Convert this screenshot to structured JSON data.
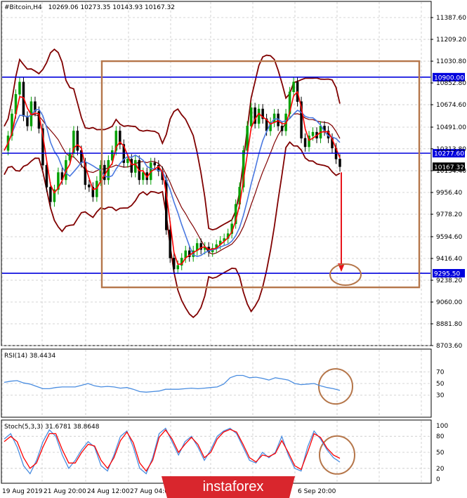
{
  "header": {
    "symbol": "#Bitcoin,H4",
    "ohlc": "10269.06 10273.35 10143.93 10167.32"
  },
  "colors": {
    "price_line_blue": "#0000dd",
    "band_color": "#800000",
    "ma_fast": "#ff0000",
    "ma_slow": "#4a78e0",
    "box_brown": "#b5764a",
    "arrow_red": "#e8141b",
    "indicator_blue": "#4a8de0",
    "watermark_bg": "#d9262d"
  },
  "main_axis": {
    "ticks": [
      "11387.60",
      "11209.20",
      "11030.80",
      "10852.80",
      "10674.60",
      "10491.00",
      "10313.80",
      "10134.40",
      "9956.40",
      "9778.20",
      "9594.60",
      "9416.40",
      "9238.20",
      "9060.00",
      "8881.80",
      "8703.60"
    ],
    "levels": [
      {
        "name": "resistance",
        "value": 10900.0,
        "label": "10900.00"
      },
      {
        "name": "pivot",
        "value": 10277.6,
        "label": "10277.60"
      },
      {
        "name": "support",
        "value": 9295.5,
        "label": "9295.50"
      }
    ],
    "current": {
      "value": 10167.32,
      "label": "10167.32"
    }
  },
  "rsi": {
    "title": "RSI(14) 38.4434",
    "ticks": [
      "70",
      "50",
      "30"
    ]
  },
  "stoch": {
    "title": "Stoch(5,3,3) 31.6781 38.8648",
    "ticks": [
      "100",
      "80",
      "50",
      "20",
      "0"
    ]
  },
  "time_axis": {
    "labels": [
      "19 Aug 2019",
      "21 Aug 20:00",
      "24 Aug 12:00",
      "27 Aug 04:00",
      "6 Sep 20:00"
    ]
  },
  "watermark": "instaforex",
  "chart_data": [
    {
      "type": "line",
      "title": "#Bitcoin,H4",
      "series": [
        {
          "name": "close",
          "values": [
            10300,
            10420,
            10600,
            10760,
            10860,
            10580,
            10500,
            10700,
            10620,
            10480,
            10180,
            10000,
            9880,
            9980,
            10120,
            10060,
            10220,
            10280,
            10460,
            10300,
            10200,
            10020,
            10000,
            9920,
            10050,
            10180,
            10060,
            10220,
            10300,
            10460,
            10350,
            10200,
            10230,
            10120,
            10220,
            10060,
            10120,
            10060,
            10200,
            10180,
            10130,
            10060,
            9650,
            9420,
            9330,
            9360,
            9420,
            9480,
            9430,
            9480,
            9540,
            9490,
            9510,
            9470,
            9500,
            9530,
            9560,
            9580,
            9620,
            9700,
            9860,
            10000,
            10300,
            10500,
            10650,
            10520,
            10640,
            10560,
            10460,
            10530,
            10600,
            10500,
            10460,
            10600,
            10780,
            10860,
            10700,
            10400,
            10330,
            10420,
            10450,
            10400,
            10500,
            10460,
            10400,
            10320,
            10230,
            10167
          ]
        },
        {
          "name": "resistance level",
          "values": [
            10900
          ]
        },
        {
          "name": "pivot level",
          "values": [
            10277.6
          ]
        },
        {
          "name": "support level",
          "values": [
            9295.5
          ]
        }
      ],
      "ylim": [
        8703.6,
        11387.6
      ]
    },
    {
      "type": "line",
      "title": "RSI(14) 38.4434",
      "series": [
        {
          "name": "RSI",
          "values": [
            52,
            54,
            55,
            51,
            49,
            45,
            41,
            41,
            43,
            44,
            44,
            44,
            47,
            50,
            46,
            44,
            45,
            44,
            42,
            43,
            40,
            36,
            35,
            36,
            37,
            40,
            40,
            40,
            41,
            42,
            41,
            42,
            43,
            44,
            49,
            60,
            64,
            64,
            60,
            61,
            59,
            56,
            60,
            58,
            56,
            50,
            48,
            49,
            50,
            46,
            43,
            41,
            38
          ]
        }
      ],
      "ylim": [
        0,
        100
      ]
    },
    {
      "type": "line",
      "title": "Stoch(5,3,3) 31.6781 38.8648",
      "series": [
        {
          "name": "main",
          "values": [
            75,
            85,
            60,
            25,
            10,
            35,
            70,
            92,
            80,
            45,
            20,
            35,
            55,
            70,
            60,
            25,
            15,
            45,
            80,
            90,
            60,
            20,
            10,
            40,
            85,
            95,
            70,
            45,
            70,
            80,
            60,
            35,
            55,
            80,
            90,
            95,
            85,
            60,
            35,
            30,
            50,
            40,
            50,
            80,
            45,
            20,
            15,
            60,
            90,
            75,
            55,
            40,
            31.6781
          ]
        },
        {
          "name": "signal",
          "values": [
            70,
            80,
            70,
            40,
            20,
            30,
            60,
            85,
            85,
            55,
            30,
            30,
            50,
            65,
            62,
            35,
            20,
            40,
            72,
            88,
            68,
            30,
            15,
            35,
            78,
            92,
            75,
            50,
            65,
            78,
            65,
            40,
            50,
            75,
            88,
            93,
            88,
            65,
            40,
            32,
            45,
            42,
            48,
            72,
            50,
            25,
            18,
            50,
            85,
            78,
            58,
            45,
            38.8648
          ]
        }
      ],
      "ylim": [
        0,
        100
      ]
    }
  ]
}
